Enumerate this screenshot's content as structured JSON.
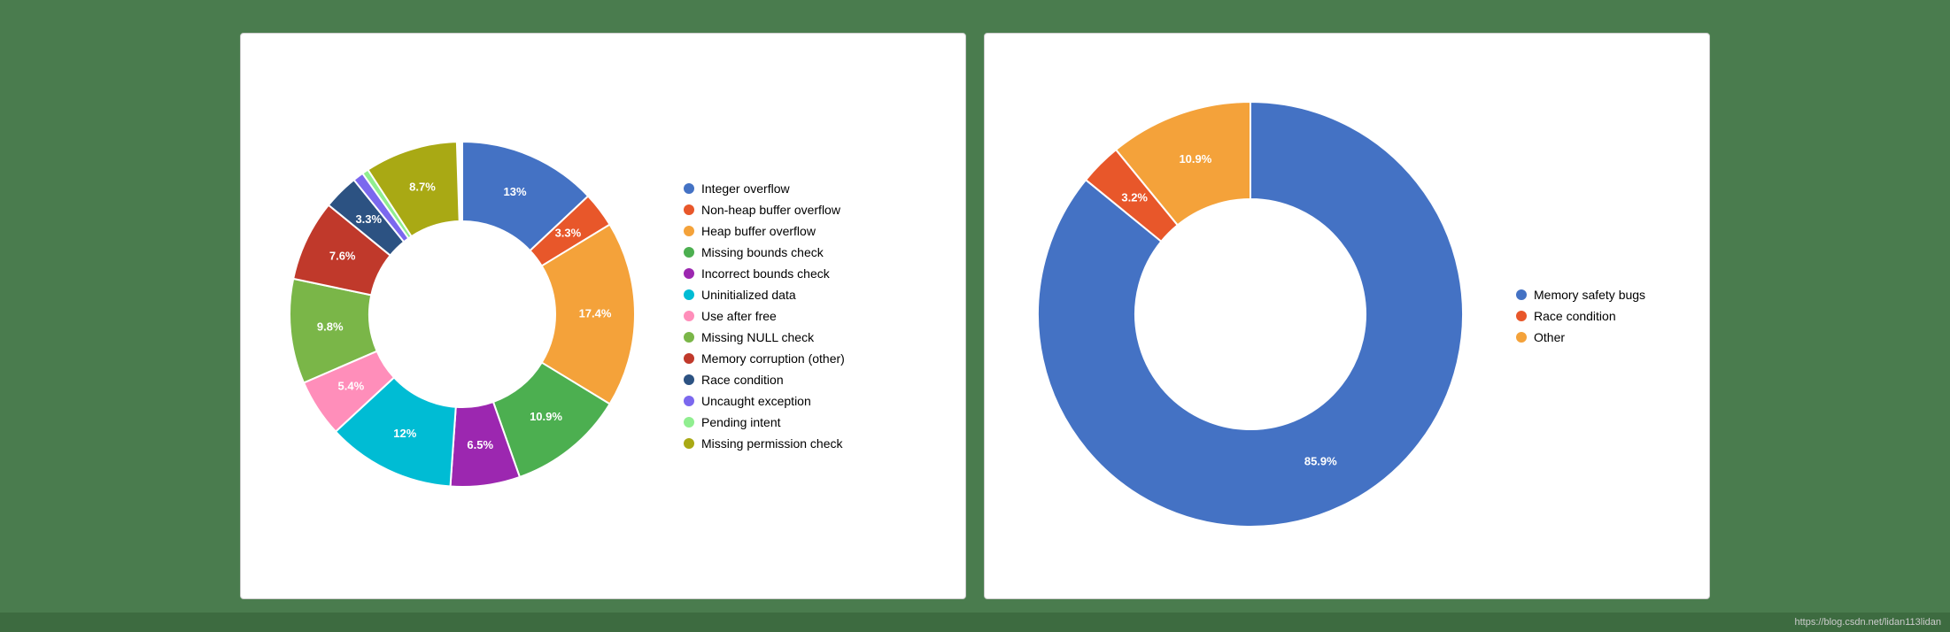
{
  "leftChart": {
    "segments": [
      {
        "label": "Integer overflow",
        "color": "#4472C4",
        "percent": 13,
        "angle": 46.8,
        "midAngle": 23.4
      },
      {
        "label": "Non-heap buffer overflow",
        "color": "#E8572A",
        "percent": 3.3,
        "angle": 11.88,
        "midAngle": 52.74
      },
      {
        "label": "Heap buffer overflow",
        "color": "#F4A23A",
        "percent": 17.4,
        "angle": 62.64,
        "midAngle": 89.46
      },
      {
        "label": "Missing bounds check",
        "color": "#4CAF50",
        "percent": 10.9,
        "angle": 39.24,
        "midAngle": 171.78
      },
      {
        "label": "Incorrect bounds check",
        "color": "#9C27B0",
        "percent": 6.5,
        "angle": 23.4,
        "midAngle": 211.02
      },
      {
        "label": "Uninitialized data",
        "color": "#00BCD4",
        "percent": 12,
        "angle": 43.2,
        "midAngle": 247.02
      },
      {
        "label": "Use after free",
        "color": "#FF69B4",
        "percent": 5.4,
        "angle": 19.44,
        "midAngle": 290.22
      },
      {
        "label": "Missing NULL check",
        "color": "#8BC34A",
        "percent": 9.8,
        "angle": 35.28,
        "midAngle": 320.06
      },
      {
        "label": "Memory corruption (other)",
        "color": "#C0392B",
        "percent": 7.6,
        "angle": 27.36,
        "midAngle": 347.78
      },
      {
        "label": "Race condition",
        "color": "#2C5282",
        "percent": 3.3,
        "angle": 11.88,
        "midAngle": 8.5
      },
      {
        "label": "Uncaught exception",
        "color": "#7B68EE",
        "percent": 1.5,
        "angle": 5.4,
        "midAngle": 356
      },
      {
        "label": "Pending intent",
        "color": "#90EE90",
        "percent": 0.5,
        "angle": 1.8,
        "midAngle": 15
      },
      {
        "label": "Missing permission check",
        "color": "#A9A914",
        "percent": 8.7,
        "angle": 31.32,
        "midAngle": 330
      }
    ]
  },
  "rightChart": {
    "segments": [
      {
        "label": "Memory safety bugs",
        "color": "#4472C4",
        "percent": 85.9,
        "angle": 309.24
      },
      {
        "label": "Race condition",
        "color": "#E8572A",
        "percent": 3.2,
        "angle": 11.52
      },
      {
        "label": "Other",
        "color": "#F4A23A",
        "percent": 10.9,
        "angle": 39.24
      }
    ]
  },
  "legend_left": [
    {
      "label": "Integer overflow",
      "color": "#4472C4"
    },
    {
      "label": "Non-heap buffer overflow",
      "color": "#E8572A"
    },
    {
      "label": "Heap buffer overflow",
      "color": "#F4A23A"
    },
    {
      "label": "Missing bounds check",
      "color": "#4CAF50"
    },
    {
      "label": "Incorrect bounds check",
      "color": "#9C27B0"
    },
    {
      "label": "Uninitialized data",
      "color": "#00BCD4"
    },
    {
      "label": "Use after free",
      "color": "#90EE90"
    },
    {
      "label": "Missing NULL check",
      "color": "#8BC34A"
    },
    {
      "label": "Memory corruption (other)",
      "color": "#C0392B"
    },
    {
      "label": "Race condition",
      "color": "#2C5282"
    },
    {
      "label": "Uncaught exception",
      "color": "#7B68EE"
    },
    {
      "label": "Pending intent",
      "color": "#90EE90"
    },
    {
      "label": "Missing permission check",
      "color": "#A9A914"
    }
  ],
  "legend_right": [
    {
      "label": "Memory safety bugs",
      "color": "#4472C4"
    },
    {
      "label": "Race condition",
      "color": "#E8572A"
    },
    {
      "label": "Other",
      "color": "#F4A23A"
    }
  ],
  "footer": "https://blog.csdn.net/lidan113lidan"
}
